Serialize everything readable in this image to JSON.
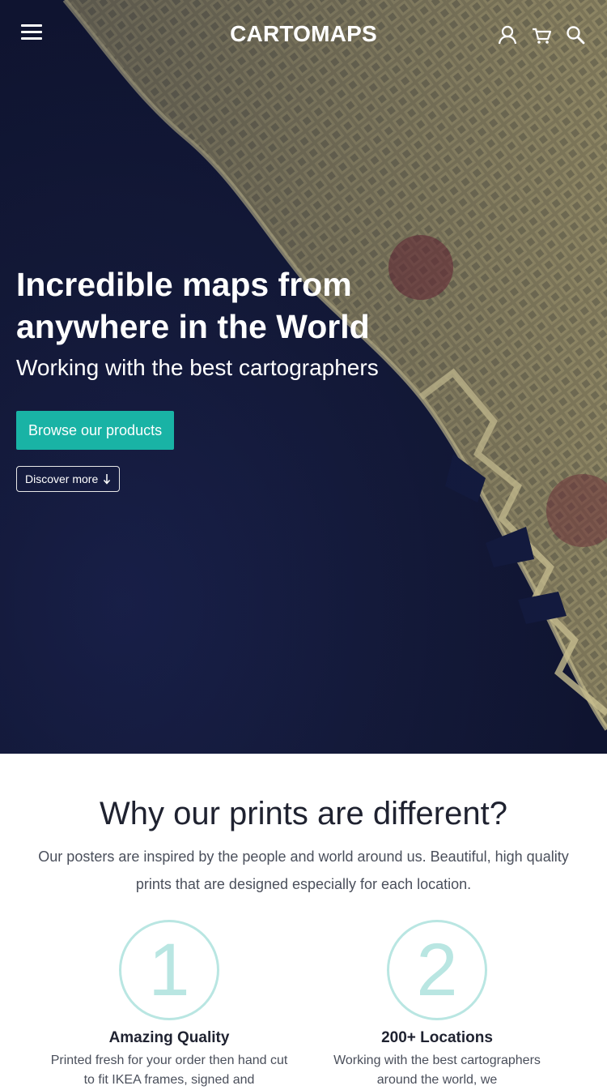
{
  "header": {
    "brand": "CARTOMAPS",
    "icons": [
      "menu-icon",
      "user-icon",
      "cart-icon",
      "search-icon"
    ]
  },
  "hero": {
    "title_line1": "Incredible maps from",
    "title_line2": "anywhere in the World",
    "subtitle": "Working with the best cartographers",
    "primary_button": "Browse our products",
    "secondary_button": "Discover more",
    "secondary_icon": "arrow-down-icon"
  },
  "why": {
    "title": "Why our prints are different?",
    "lead": "Our posters are inspired by the people and world around us. Beautiful, high quality prints that are designed especially for each location.",
    "features": [
      {
        "number": "1",
        "title": "Amazing Quality",
        "desc": "Printed fresh for your order then hand cut to fit IKEA frames, signed and"
      },
      {
        "number": "2",
        "title": "200+ Locations",
        "desc": "Working with the best cartographers around the world, we"
      }
    ]
  },
  "colors": {
    "accent": "#19b3a5",
    "circle": "#b9e6e2",
    "ocean": "#141a3a",
    "land": "#8a8260"
  }
}
